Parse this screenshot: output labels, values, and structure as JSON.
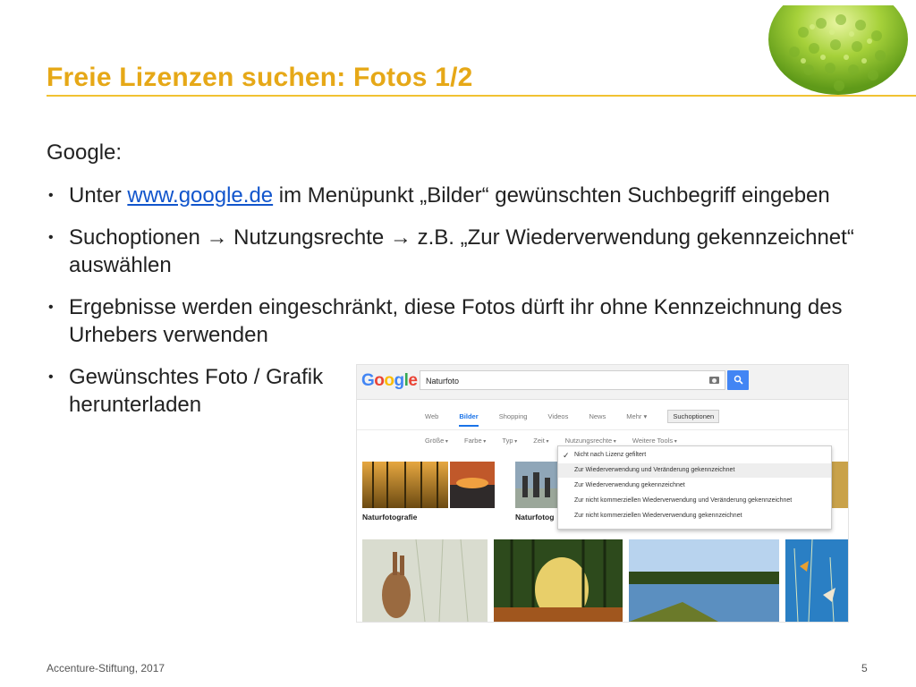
{
  "slide": {
    "title": "Freie Lizenzen suchen: Fotos 1/2",
    "intro": "Google:",
    "bullets": [
      {
        "pre": "Unter ",
        "link": "www.google.de",
        "post": " im Menüpunkt „Bilder“ gewünschten Suchbegriff eingeben"
      },
      {
        "a": "Suchoptionen ",
        "b": " Nutzungsrechte ",
        "c": " z.B. „Zur Wiederverwendung gekennzeichnet“ auswählen"
      },
      {
        "text": "Ergebnisse werden eingeschränkt, diese Fotos dürft ihr ohne Kennzeichnung des Urhebers verwenden"
      },
      {
        "text": "Gewünschtes Foto / Grafik herunterladen"
      }
    ],
    "footer_left": "Accenture-Stiftung, 2017",
    "page_number": "5"
  },
  "google": {
    "logo_letters": [
      "G",
      "o",
      "o",
      "g",
      "l",
      "e"
    ],
    "logo_colors": [
      "#4285f4",
      "#ea4335",
      "#fbbc05",
      "#4285f4",
      "#34a853",
      "#ea4335"
    ],
    "search_value": "Naturfoto",
    "tabs": [
      "Web",
      "Bilder",
      "Shopping",
      "Videos",
      "News",
      "Mehr",
      "Suchoptionen"
    ],
    "tools": [
      "Größe",
      "Farbe",
      "Typ",
      "Zeit",
      "Nutzungsrechte",
      "Weitere Tools"
    ],
    "tile_labels": [
      "Naturfotografie",
      "Naturfotog"
    ],
    "menu_items": [
      "Nicht nach Lizenz gefiltert",
      "Zur Wiederverwendung und Veränderung gekennzeichnet",
      "Zur Wiederverwendung gekennzeichnet",
      "Zur nicht kommerziellen Wiederverwendung und Veränderung gekennzeichnet",
      "Zur nicht kommerziellen Wiederverwendung gekennzeichnet"
    ],
    "accent": "#4285f4"
  },
  "colors": {
    "title": "#e6a817",
    "link": "#1155cc"
  }
}
